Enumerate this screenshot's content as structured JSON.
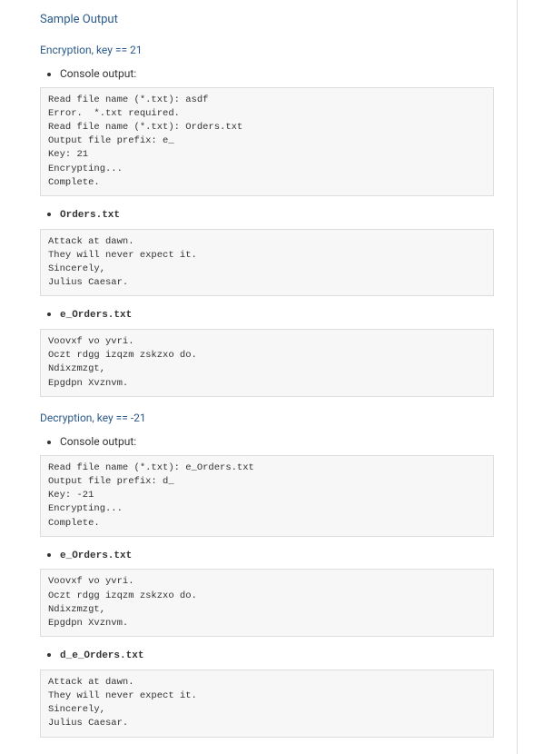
{
  "page": {
    "title": "Sample Output"
  },
  "encryption": {
    "heading": "Encryption, key == 21",
    "console_label": "Console output:",
    "console_output": "Read file name (*.txt): asdf\nError.  *.txt required.\nRead file name (*.txt): Orders.txt\nOutput file prefix: e_\nKey: 21\nEncrypting...\nComplete.",
    "file1_label": "Orders.txt",
    "file1_contents": "Attack at dawn.\nThey will never expect it.\nSincerely,\nJulius Caesar.",
    "file2_label": "e_Orders.txt",
    "file2_contents": "Voovxf vo yvri.\nOczt rdgg izqzm zskzxo do.\nNdixzmzgt,\nEpgdpn Xvznvm."
  },
  "decryption": {
    "heading": "Decryption, key == -21",
    "console_label": "Console output:",
    "console_output": "Read file name (*.txt): e_Orders.txt\nOutput file prefix: d_\nKey: -21\nEncrypting...\nComplete.",
    "file1_label": "e_Orders.txt",
    "file1_contents": "Voovxf vo yvri.\nOczt rdgg izqzm zskzxo do.\nNdixzmzgt,\nEpgdpn Xvznvm.",
    "file2_label": "d_e_Orders.txt",
    "file2_contents": "Attack at dawn.\nThey will never expect it.\nSincerely,\nJulius Caesar."
  }
}
